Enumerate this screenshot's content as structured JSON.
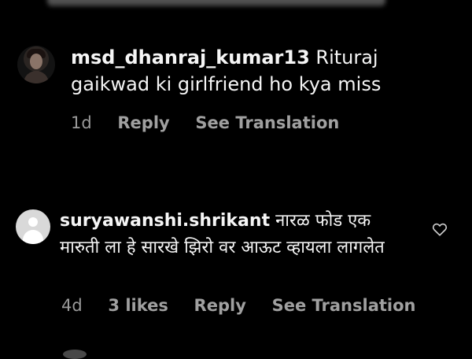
{
  "comments": [
    {
      "username": "msd_dhanraj_kumar13",
      "text": " Rituraj gaikwad ki girlfriend ho kya miss",
      "time": "1d",
      "likes": "",
      "reply_label": "Reply",
      "translation_label": "See Translation"
    },
    {
      "username": "suryawanshi.shrikant",
      "text": " नारळ फोड एक मारुती ला हे सारखे झिरो वर आऊट व्हायला लागलेत",
      "time": "4d",
      "likes": "3 likes",
      "reply_label": "Reply",
      "translation_label": "See Translation"
    }
  ],
  "icons": {
    "like": "heart-outline-icon"
  }
}
